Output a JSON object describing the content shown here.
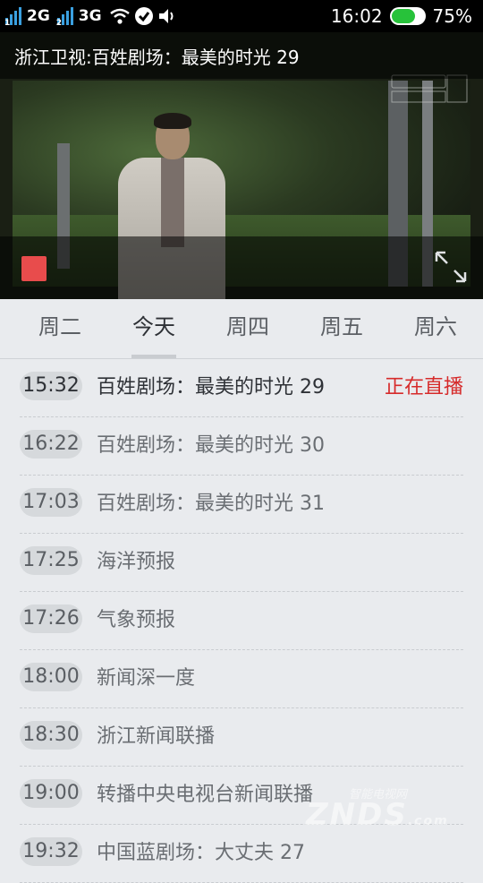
{
  "status_bar": {
    "sim1_net": "2G",
    "sim2_net": "3G",
    "time": "16:02",
    "battery": "75%"
  },
  "player": {
    "title": "浙江卫视:百姓剧场：最美的时光 29",
    "controls": {
      "stop": "stop",
      "fullscreen": "expand"
    }
  },
  "day_tabs": [
    {
      "label": "周二",
      "active": false
    },
    {
      "label": "今天",
      "active": true
    },
    {
      "label": "周四",
      "active": false
    },
    {
      "label": "周五",
      "active": false
    },
    {
      "label": "周六",
      "active": false
    }
  ],
  "schedule": [
    {
      "time": "15:32",
      "program": "百姓剧场：最美的时光 29",
      "status": "正在直播"
    },
    {
      "time": "16:22",
      "program": "百姓剧场：最美的时光 30"
    },
    {
      "time": "17:03",
      "program": "百姓剧场：最美的时光 31"
    },
    {
      "time": "17:25",
      "program": "海洋预报"
    },
    {
      "time": "17:26",
      "program": "气象预报"
    },
    {
      "time": "18:00",
      "program": "新闻深一度"
    },
    {
      "time": "18:30",
      "program": "浙江新闻联播"
    },
    {
      "time": "19:00",
      "program": "转播中央电视台新闻联播"
    },
    {
      "time": "19:32",
      "program": "中国蓝剧场：大丈夫 27"
    }
  ],
  "watermark": {
    "text": "ZNDS",
    "sub": "智能电视网",
    "suffix": ".com"
  },
  "colors": {
    "live": "#d62b2b",
    "stop": "#e84c4c",
    "battery": "#27c23a"
  }
}
